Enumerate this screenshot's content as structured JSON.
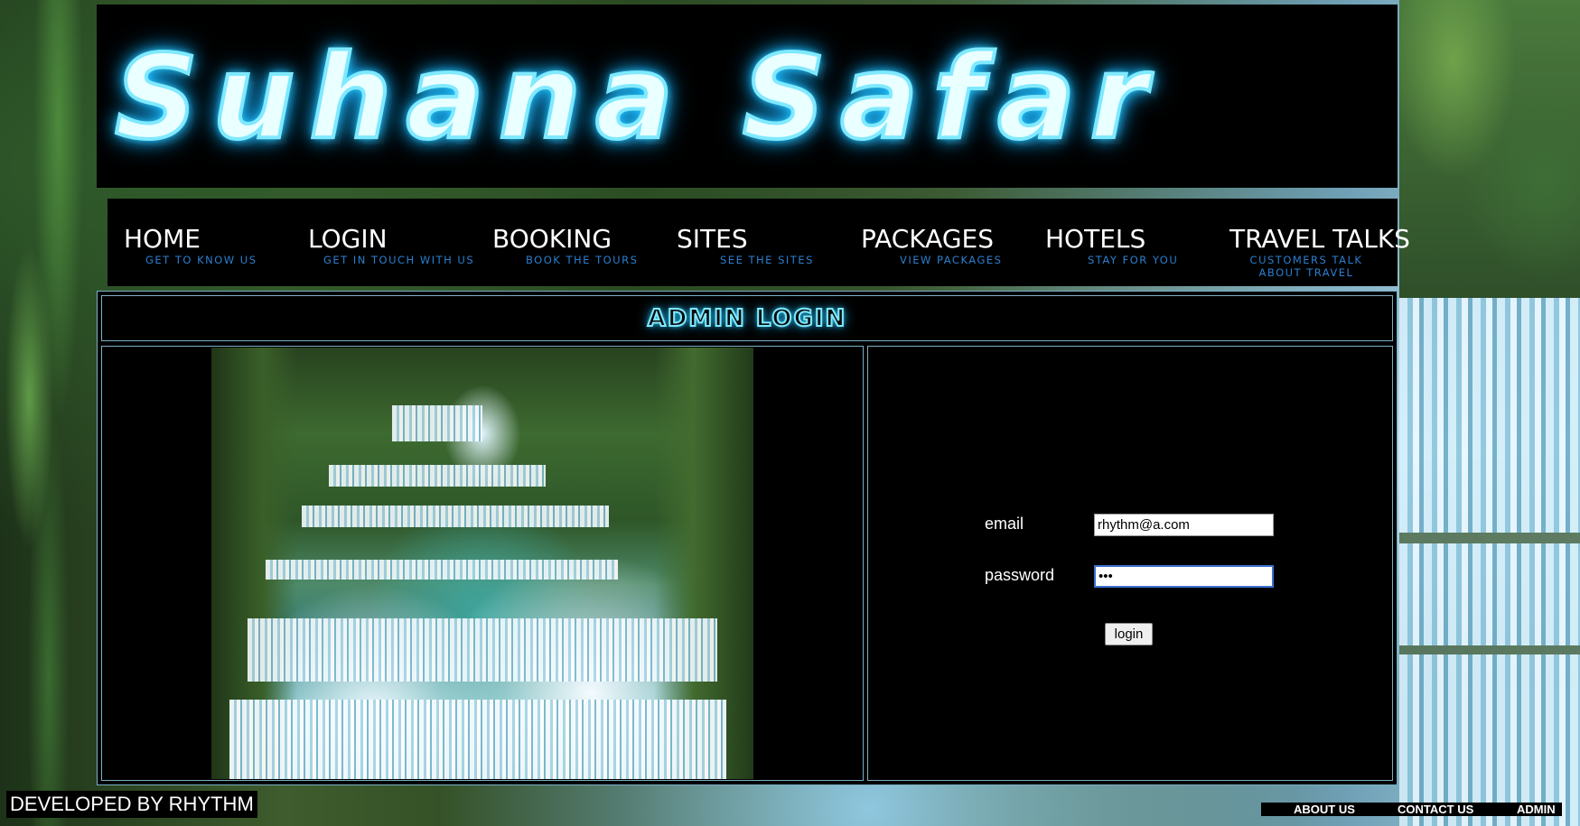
{
  "header": {
    "logo_text": "Suhana Safar"
  },
  "nav": {
    "items": [
      {
        "label": "HOME",
        "subtitle": "GET TO KNOW US"
      },
      {
        "label": "LOGIN",
        "subtitle": "GET IN TOUCH WITH US"
      },
      {
        "label": "BOOKING",
        "subtitle": "BOOK THE TOURS"
      },
      {
        "label": "SITES",
        "subtitle": "SEE THE SITES"
      },
      {
        "label": "PACKAGES",
        "subtitle": "VIEW PACKAGES"
      },
      {
        "label": "HOTELS",
        "subtitle": "STAY FOR YOU"
      },
      {
        "label": "TRAVEL TALKS",
        "subtitle": "CUSTOMERS TALK ABOUT TRAVEL"
      }
    ]
  },
  "main": {
    "title": "ADMIN LOGIN",
    "form": {
      "email_label": "email",
      "email_value": "rhythm@a.com",
      "password_label": "password",
      "password_value": "•••",
      "submit_label": "login"
    }
  },
  "footer": {
    "credit": "DEVELOPED BY RHYTHM",
    "links": [
      "ABOUT US",
      "CONTACT US",
      "ADMIN"
    ]
  },
  "colors": {
    "neon": "#7fe9ff",
    "nav_subtitle": "#2b7fd0",
    "panel_border": "#7ab0c4",
    "panel_bg": "#000000"
  },
  "icons": {
    "logo": "neon-logo-text",
    "hero_image": "waterfall-photo"
  }
}
